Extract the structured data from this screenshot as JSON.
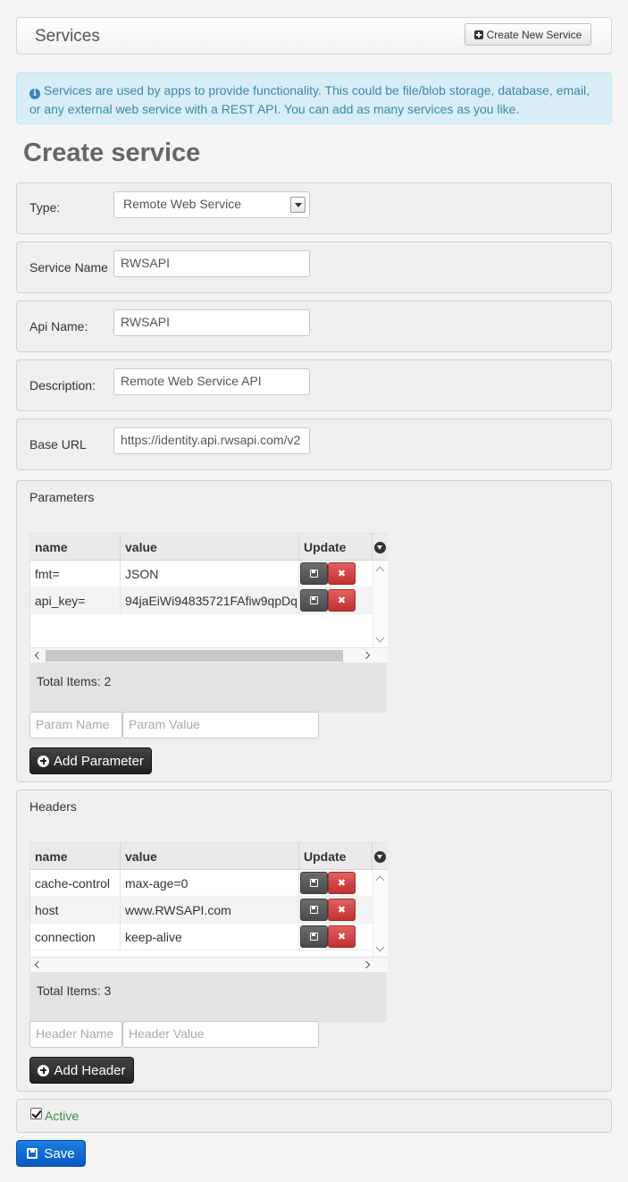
{
  "header": {
    "title": "Services",
    "create_button": "Create New Service"
  },
  "info": {
    "text": "Services are used by apps to provide functionality. This could be file/blob storage, database, email, or any external web service with a REST API. You can add as many services as you like."
  },
  "page_title": "Create service",
  "form": {
    "type": {
      "label": "Type:",
      "value": "Remote Web Service"
    },
    "service_name": {
      "label": "Service Name",
      "value": "RWSAPI"
    },
    "api_name": {
      "label": "Api Name:",
      "value": "RWSAPI"
    },
    "description": {
      "label": "Description:",
      "value": "Remote Web Service API"
    },
    "base_url": {
      "label": "Base URL",
      "value": "https://identity.api.rwsapi.com/v2"
    }
  },
  "parameters": {
    "title": "Parameters",
    "columns": [
      "name",
      "value",
      "Update"
    ],
    "rows": [
      {
        "name": "fmt=",
        "value": "JSON"
      },
      {
        "name": "api_key=",
        "value": "94jaEiWi94835721FAfiw9qpDq"
      }
    ],
    "total": "Total Items: 2",
    "name_placeholder": "Param Name",
    "value_placeholder": "Param Value",
    "add_button": "Add Parameter"
  },
  "headers": {
    "title": "Headers",
    "columns": [
      "name",
      "value",
      "Update"
    ],
    "rows": [
      {
        "name": "cache-control",
        "value": "max-age=0"
      },
      {
        "name": "host",
        "value": "www.RWSAPI.com"
      },
      {
        "name": "connection",
        "value": "keep-alive"
      }
    ],
    "total": "Total Items: 3",
    "name_placeholder": "Header Name",
    "value_placeholder": "Header Value",
    "add_button": "Add Header"
  },
  "active": {
    "label": "Active",
    "checked": true,
    "color": "#3c8b3c"
  },
  "save_button": "Save",
  "colors": {
    "info_bg": "#d9edf7",
    "info_text": "#3a87ad",
    "save_blue": "#0a58c2",
    "delete_red": "#c0302e"
  }
}
